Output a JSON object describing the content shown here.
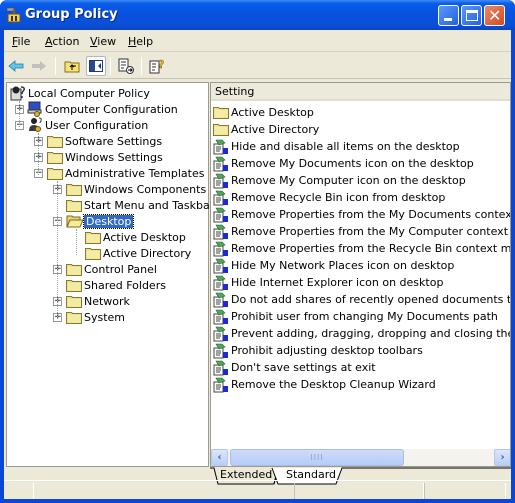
{
  "window": {
    "title": "Group Policy",
    "controls": {
      "minimize": "minimize",
      "maximize": "maximize",
      "close": "close"
    }
  },
  "menubar": {
    "items": [
      {
        "label": "File",
        "accel": "F",
        "rest": "ile"
      },
      {
        "label": "Action",
        "accel": "A",
        "rest": "ction"
      },
      {
        "label": "View",
        "accel": "V",
        "rest": "iew"
      },
      {
        "label": "Help",
        "accel": "H",
        "rest": "elp"
      }
    ]
  },
  "toolbar": {
    "buttons": [
      {
        "name": "back",
        "icon": "back-arrow-icon",
        "enabled": true
      },
      {
        "name": "forward",
        "icon": "forward-arrow-icon",
        "enabled": false
      },
      {
        "name": "up-one-level",
        "icon": "folder-up-icon",
        "enabled": true
      },
      {
        "name": "show-hide-console-tree",
        "icon": "console-tree-icon",
        "pressed": true
      },
      {
        "name": "export-list",
        "icon": "export-list-icon",
        "enabled": true
      },
      {
        "name": "help",
        "icon": "help-icon",
        "enabled": true
      }
    ]
  },
  "tree": {
    "items": [
      {
        "label": "Local Computer Policy",
        "icon": "policy-icon",
        "level": 0,
        "expander": "none"
      },
      {
        "label": "Computer Configuration",
        "icon": "computer-config-icon",
        "level": 1,
        "expander": "+"
      },
      {
        "label": "User Configuration",
        "icon": "user-config-icon",
        "level": 1,
        "expander": "-"
      },
      {
        "label": "Software Settings",
        "icon": "folder-icon",
        "level": 2,
        "expander": "+"
      },
      {
        "label": "Windows Settings",
        "icon": "folder-icon",
        "level": 2,
        "expander": "+"
      },
      {
        "label": "Administrative Templates",
        "icon": "folder-icon",
        "level": 2,
        "expander": "-"
      },
      {
        "label": "Windows Components",
        "icon": "folder-icon",
        "level": 3,
        "expander": "+"
      },
      {
        "label": "Start Menu and Taskbar",
        "icon": "folder-icon",
        "level": 3,
        "expander": "none"
      },
      {
        "label": "Desktop",
        "icon": "folder-open-icon",
        "level": 3,
        "expander": "-",
        "selected": true
      },
      {
        "label": "Active Desktop",
        "icon": "folder-icon",
        "level": 4,
        "expander": "none"
      },
      {
        "label": "Active Directory",
        "icon": "folder-icon",
        "level": 4,
        "expander": "none"
      },
      {
        "label": "Control Panel",
        "icon": "folder-icon",
        "level": 3,
        "expander": "+"
      },
      {
        "label": "Shared Folders",
        "icon": "folder-icon",
        "level": 3,
        "expander": "none"
      },
      {
        "label": "Network",
        "icon": "folder-icon",
        "level": 3,
        "expander": "+"
      },
      {
        "label": "System",
        "icon": "folder-icon",
        "level": 3,
        "expander": "+"
      }
    ]
  },
  "list": {
    "column_header": "Setting",
    "items": [
      {
        "label": "Active Desktop",
        "icon": "folder-icon"
      },
      {
        "label": "Active Directory",
        "icon": "folder-icon"
      },
      {
        "label": "Hide and disable all items on the desktop",
        "icon": "policy-setting-icon"
      },
      {
        "label": "Remove My Documents icon on the desktop",
        "icon": "policy-setting-icon"
      },
      {
        "label": "Remove My Computer icon on the desktop",
        "icon": "policy-setting-icon"
      },
      {
        "label": "Remove Recycle Bin icon from desktop",
        "icon": "policy-setting-icon"
      },
      {
        "label": "Remove Properties from the My Documents context menu",
        "icon": "policy-setting-icon"
      },
      {
        "label": "Remove Properties from the My Computer context menu",
        "icon": "policy-setting-icon"
      },
      {
        "label": "Remove Properties from the Recycle Bin context menu",
        "icon": "policy-setting-icon"
      },
      {
        "label": "Hide My Network Places icon on desktop",
        "icon": "policy-setting-icon"
      },
      {
        "label": "Hide Internet Explorer icon on desktop",
        "icon": "policy-setting-icon"
      },
      {
        "label": "Do not add shares of recently opened documents to My Network Places",
        "icon": "policy-setting-icon"
      },
      {
        "label": "Prohibit user from changing My Documents path",
        "icon": "policy-setting-icon"
      },
      {
        "label": "Prevent adding, dragging, dropping and closing the Taskbar's toolbars",
        "icon": "policy-setting-icon"
      },
      {
        "label": "Prohibit adjusting desktop toolbars",
        "icon": "policy-setting-icon"
      },
      {
        "label": "Don't save settings at exit",
        "icon": "policy-setting-icon"
      },
      {
        "label": "Remove the Desktop Cleanup Wizard",
        "icon": "policy-setting-icon"
      }
    ]
  },
  "tabs": [
    {
      "label": "Extended",
      "active": false
    },
    {
      "label": "Standard",
      "active": true
    }
  ],
  "scrollbar": {
    "thumb_grip": "IIII"
  },
  "colors": {
    "titlebar": "#0a5ce8",
    "selection": "#316ac5",
    "chrome": "#ece9d8",
    "close_button": "#d44a22"
  }
}
